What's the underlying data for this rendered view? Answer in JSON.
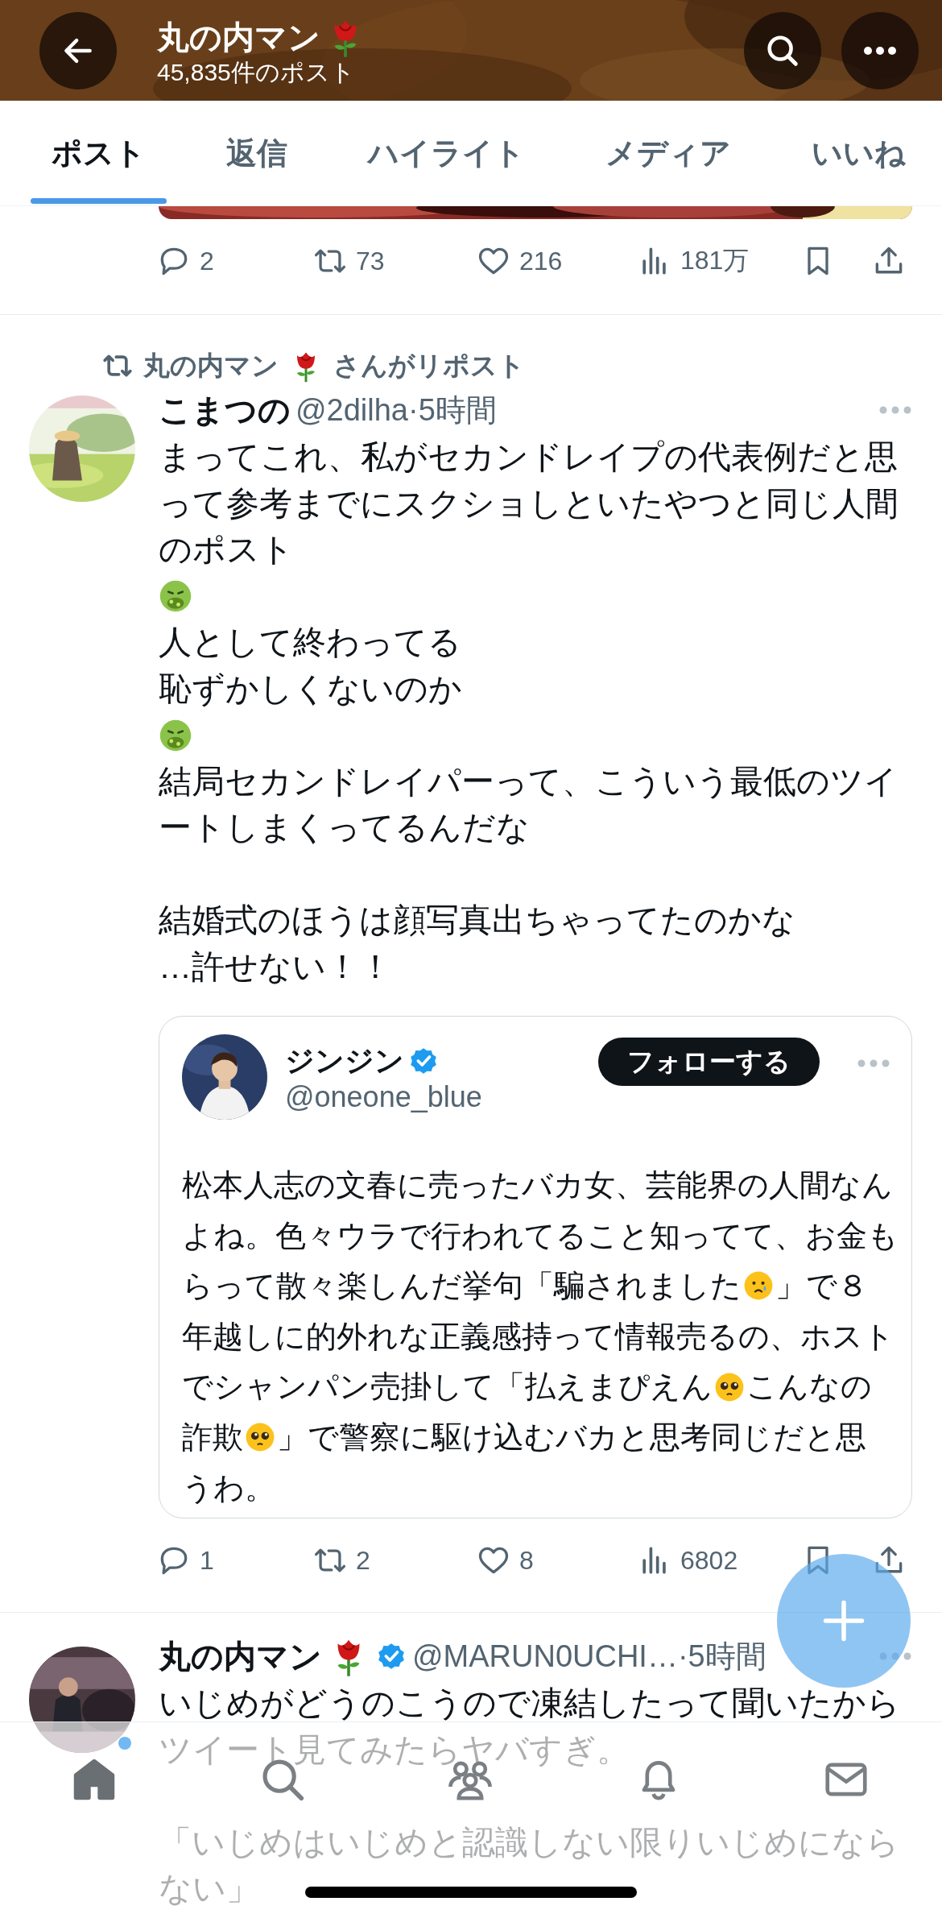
{
  "header": {
    "title": "丸の内マン",
    "title_badges": [
      {
        "kind": "rose"
      }
    ],
    "post_count": "45,835件のポスト"
  },
  "tabs": [
    {
      "label": "ポスト",
      "selected": true
    },
    {
      "label": "返信",
      "selected": false
    },
    {
      "label": "ハイライト",
      "selected": false
    },
    {
      "label": "メディア",
      "selected": false
    },
    {
      "label": "いいね",
      "selected": false
    }
  ],
  "previous_post": {
    "stats": {
      "replies": "2",
      "reposts": "73",
      "likes": "216",
      "views": "181万"
    }
  },
  "repost": {
    "reposted_by": {
      "name": "丸の内マン",
      "badges": [
        {
          "kind": "rose"
        }
      ],
      "suffix": "さんがリポスト"
    },
    "author": {
      "name": "こまつの",
      "handle": "@2dilha",
      "time": "·5時間"
    },
    "body": [
      {
        "kind": "text",
        "text": "まってこれ、私がセカンドレイプの代表例だと思って参考までにスクショしといたやつと同じ人間のポスト"
      },
      {
        "kind": "nauseated"
      },
      {
        "kind": "text",
        "text": "人として終わってる"
      },
      {
        "kind": "text",
        "text": "恥ずかしくないのか"
      },
      {
        "kind": "nauseated"
      },
      {
        "kind": "text",
        "text": "結局セカンドレイパーって、こういう最低のツイートしまくってるんだな"
      },
      {
        "kind": "gap"
      },
      {
        "kind": "text",
        "text": "結婚式のほうは顔写真出ちゃってたのかな"
      },
      {
        "kind": "text",
        "text": "…許せない！！"
      }
    ],
    "quote": {
      "author": {
        "name": "ジンジン",
        "badges": [
          {
            "kind": "verified"
          }
        ],
        "handle": "@oneone_blue"
      },
      "follow_button": "フォローする",
      "lines": [
        [
          {
            "kind": "text",
            "text": "松本人志の文春に売ったバカ女、芸能界の人間なん"
          }
        ],
        [
          {
            "kind": "text",
            "text": "よね。色々ウラで行われてること知ってて、お金も"
          }
        ],
        [
          {
            "kind": "text",
            "text": "らって散々楽しんだ挙句「騙されました"
          },
          {
            "kind": "crying"
          },
          {
            "kind": "text",
            "text": "」で８"
          }
        ],
        [
          {
            "kind": "text",
            "text": "年越しに的外れな正義感持って情報売るの、ホスト"
          }
        ],
        [
          {
            "kind": "text",
            "text": "でシャンパン売掛して「払えまぴえん"
          },
          {
            "kind": "pleading"
          },
          {
            "kind": "text",
            "text": "こんなの"
          }
        ],
        [
          {
            "kind": "text",
            "text": "詐欺"
          },
          {
            "kind": "pleading"
          },
          {
            "kind": "text",
            "text": "」で警察に駆け込むバカと思考同じだと思"
          }
        ],
        [
          {
            "kind": "text",
            "text": "うわ。"
          }
        ]
      ]
    },
    "stats": {
      "replies": "1",
      "reposts": "2",
      "likes": "8",
      "views": "6802"
    }
  },
  "next_post": {
    "author": {
      "name": "丸の内マン",
      "badges": [
        {
          "kind": "rose"
        },
        {
          "kind": "verified"
        }
      ],
      "handle": "@MARUN0UCHI…",
      "time": "·5時間"
    },
    "body": [
      {
        "kind": "text",
        "text": "いじめがどうのこうので凍結したって聞いたからツイート見てみたらヤバすぎ。"
      },
      {
        "kind": "gap"
      },
      {
        "kind": "text",
        "text": "「いじめはいじめと認識しない限りいじめになら"
      },
      {
        "kind": "text",
        "text": "ない」"
      }
    ]
  },
  "nav": [
    {
      "kind": "home",
      "selected": true,
      "dot": true
    },
    {
      "kind": "search",
      "selected": false,
      "dot": false
    },
    {
      "kind": "communities",
      "selected": false,
      "dot": false
    },
    {
      "kind": "notifications",
      "selected": false,
      "dot": false
    },
    {
      "kind": "messages",
      "selected": false,
      "dot": false
    }
  ]
}
